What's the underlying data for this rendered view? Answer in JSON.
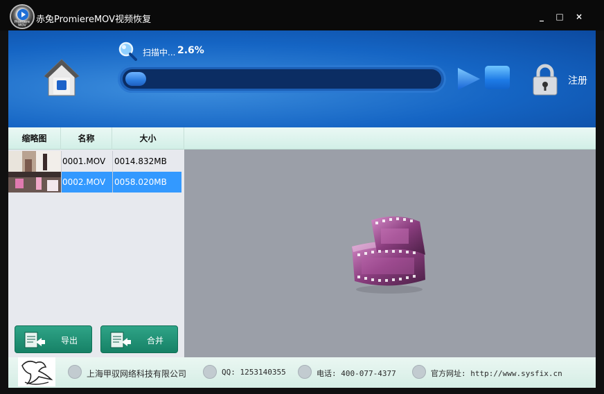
{
  "window": {
    "title": "赤兔PromiereMOV视频恢复",
    "logo_caption": "Promiere MOV",
    "minimize": "_",
    "maximize": "□",
    "close": "×"
  },
  "scan": {
    "status_label": "扫描中...",
    "percent_label": "2.6%",
    "progress": 0.026
  },
  "register_label": "注册",
  "columns": [
    "缩略图",
    "名称",
    "大小"
  ],
  "files": [
    {
      "name": "0001.MOV",
      "size": "0014.832MB",
      "selected": false
    },
    {
      "name": "0002.MOV",
      "size": "0058.020MB",
      "selected": true
    }
  ],
  "actions": {
    "export_label": "导出",
    "merge_label": "合并"
  },
  "footer": {
    "company": "上海甲驭网络科技有限公司",
    "qq": "QQ: 1253140355",
    "phone": "电话: 400-077-4377",
    "website": "官方网址: http://www.sysfix.cn"
  },
  "colors": {
    "accent": "#1565c4",
    "selection": "#3399ff",
    "button_green": "#168166"
  }
}
